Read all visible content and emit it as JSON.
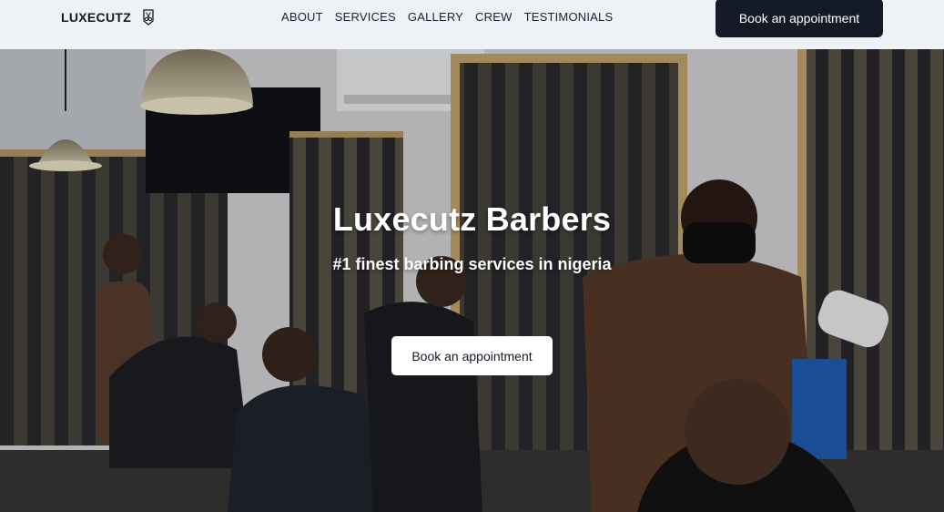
{
  "nav": {
    "brand": "LUXECUTZ",
    "brand_icon": "scissors-badge-icon",
    "links": [
      "ABOUT",
      "SERVICES",
      "GALLERY",
      "CREW",
      "TESTIMONIALS"
    ],
    "cta_label": "Book an appointment"
  },
  "hero": {
    "title": "Luxecutz Barbers",
    "subtitle": "#1 finest barbing services in nigeria",
    "cta_label": "Book an appointment",
    "image": "barbershop-photo"
  },
  "colors": {
    "nav_bg": "#eef1f6",
    "primary_dark": "#141a28",
    "hero_text": "#ffffff"
  }
}
